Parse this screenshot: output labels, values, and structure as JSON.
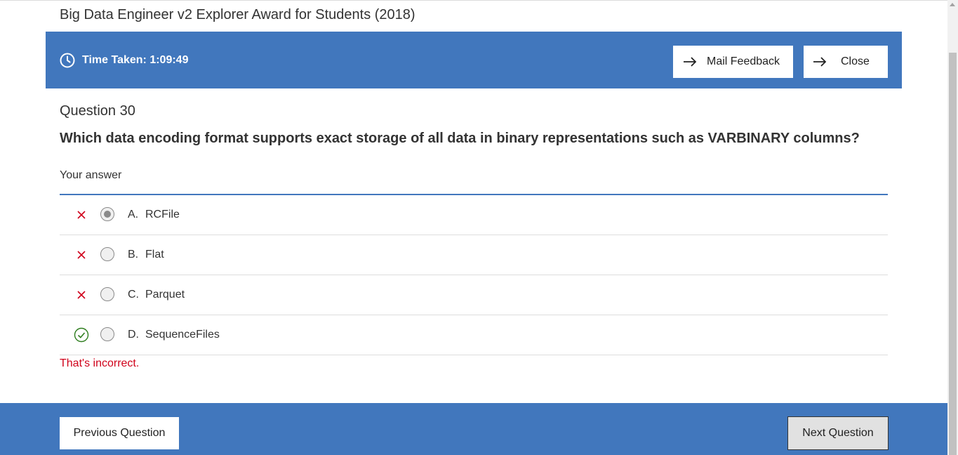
{
  "page": {
    "title": "Big Data Engineer v2 Explorer Award for Students (2018)"
  },
  "header": {
    "timer_icon": "clock-icon",
    "timer_text": "Time Taken: 1:09:49",
    "mail_feedback_label": "Mail Feedback",
    "close_label": "Close",
    "arrow_icon": "arrow-right-icon"
  },
  "question": {
    "number_label": "Question 30",
    "text": "Which data encoding format supports exact storage of all data in binary representations such as VARBINARY columns?",
    "your_answer_label": "Your answer",
    "options": [
      {
        "letter": "A.",
        "text": "RCFile",
        "mark": "cross-icon",
        "selected": true,
        "correct": false
      },
      {
        "letter": "B.",
        "text": "Flat",
        "mark": "cross-icon",
        "selected": false,
        "correct": false
      },
      {
        "letter": "C.",
        "text": "Parquet",
        "mark": "cross-icon",
        "selected": false,
        "correct": false
      },
      {
        "letter": "D.",
        "text": "SequenceFiles",
        "mark": "check-circle-icon",
        "selected": false,
        "correct": true
      }
    ],
    "feedback": "That's incorrect."
  },
  "footer": {
    "previous_label": "Previous Question",
    "next_label": "Next Question"
  },
  "colors": {
    "brand_blue": "#4177bd",
    "incorrect_red": "#d0021b",
    "correct_green": "#2e7d1e"
  }
}
